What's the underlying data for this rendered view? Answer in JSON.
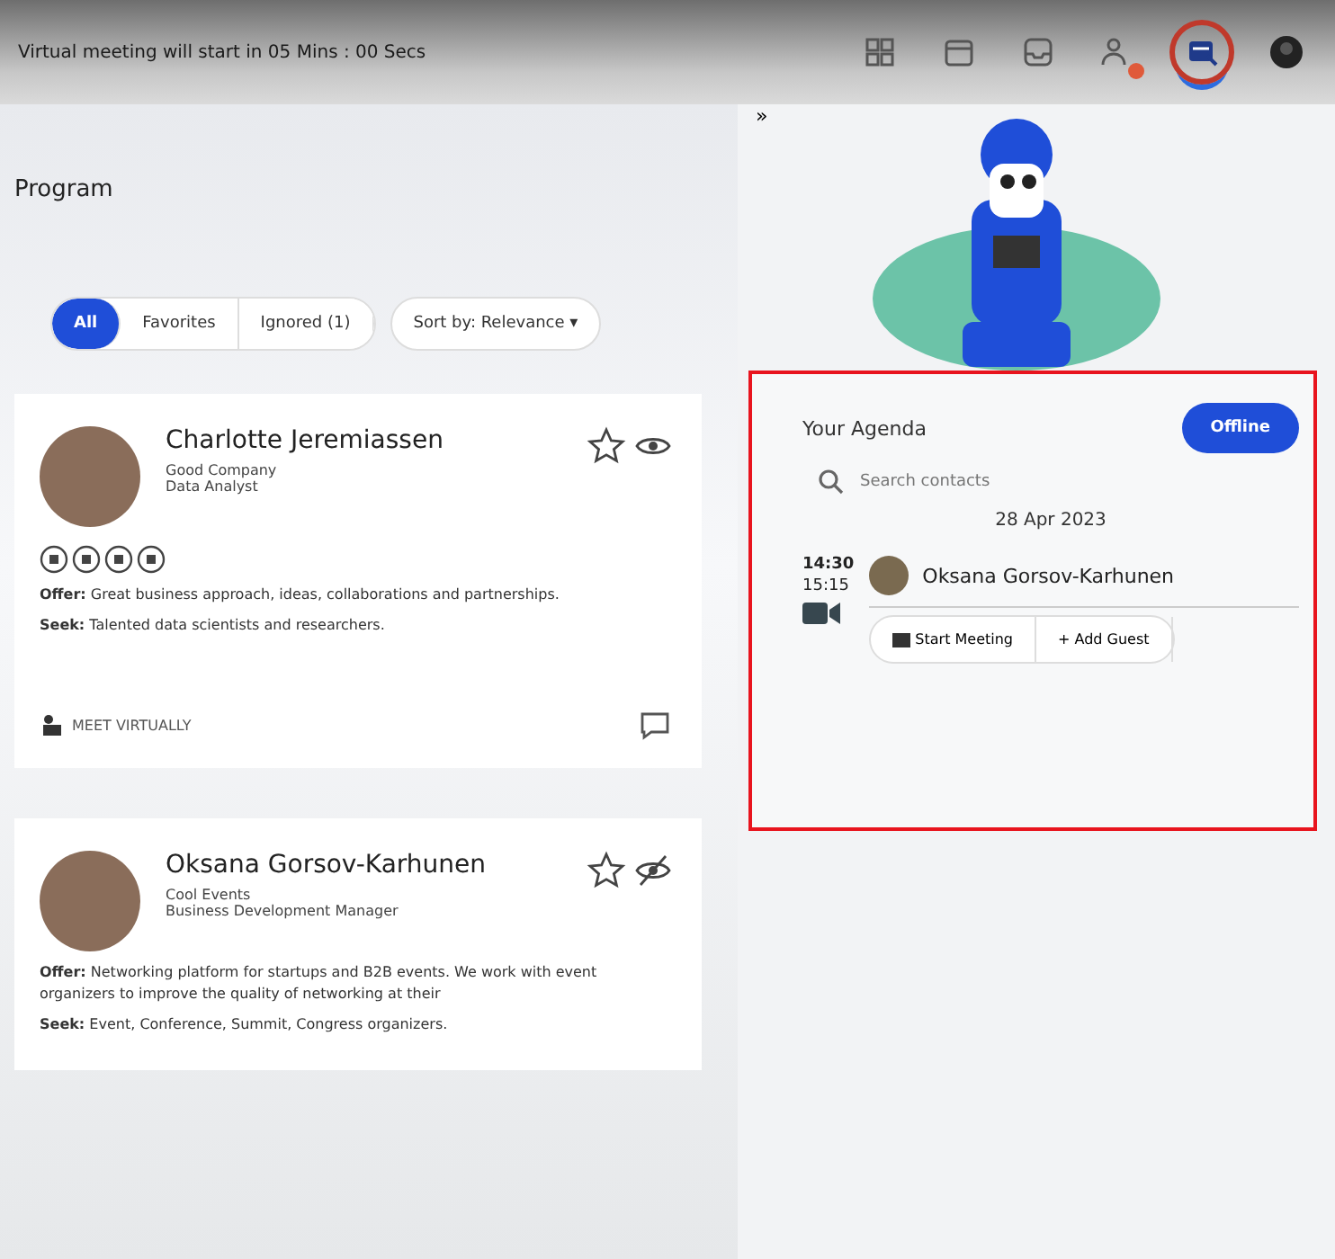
{
  "top_bar": {
    "countdown": "Virtual meeting will start in 05 Mins : 00 Secs",
    "icons": [
      {
        "kind": "grid",
        "badge": false,
        "selected": false
      },
      {
        "kind": "calendar",
        "badge": false,
        "selected": false
      },
      {
        "kind": "inbox",
        "badge": false,
        "selected": false
      },
      {
        "kind": "people",
        "badge": true,
        "selected": false
      },
      {
        "kind": "agenda",
        "badge": false,
        "selected": true
      },
      {
        "kind": "avatar",
        "badge": false,
        "selected": false
      }
    ]
  },
  "collapse_toggle": "»",
  "program": {
    "title": "Program",
    "filters": [
      {
        "label": "All",
        "selected": true
      },
      {
        "label": "Favorites",
        "selected": false
      },
      {
        "label": "Ignored (1)",
        "selected": false
      }
    ],
    "sort": "Sort by: Relevance ▾",
    "people": [
      {
        "name": "Charlotte Jeremiassen",
        "company": "Good Company",
        "role": "Data Analyst",
        "favorite": false,
        "ignored": false,
        "socials": true,
        "offer": "**Offer:** Great business approach, ideas, collaborations and partnerships.",
        "seek": "**Seek:** Talented data scientists and researchers.",
        "meet": "MEET VIRTUALLY"
      },
      {
        "name": "Oksana Gorsov-Karhunen",
        "company": "Cool Events",
        "role": "Business Development Manager",
        "favorite": false,
        "ignored": true,
        "socials": false,
        "offer": "**Offer:** Networking platform for startups and B2B events. We work with event organizers to improve the quality of networking at their",
        "seek": "**Seek:** Event, Conference, Summit, Congress organizers."
      }
    ]
  },
  "agenda": {
    "title": "Your Agenda",
    "status_button": "Offline",
    "search": {
      "placeholder": "Search contacts"
    },
    "date": "28 Apr 2023",
    "meetings": [
      {
        "start": "14:30",
        "end": "15:15",
        "name": "Oksana Gorsov-Karhunen",
        "actions": [
          "Start Meeting",
          "+ Add Guest"
        ]
      }
    ]
  }
}
